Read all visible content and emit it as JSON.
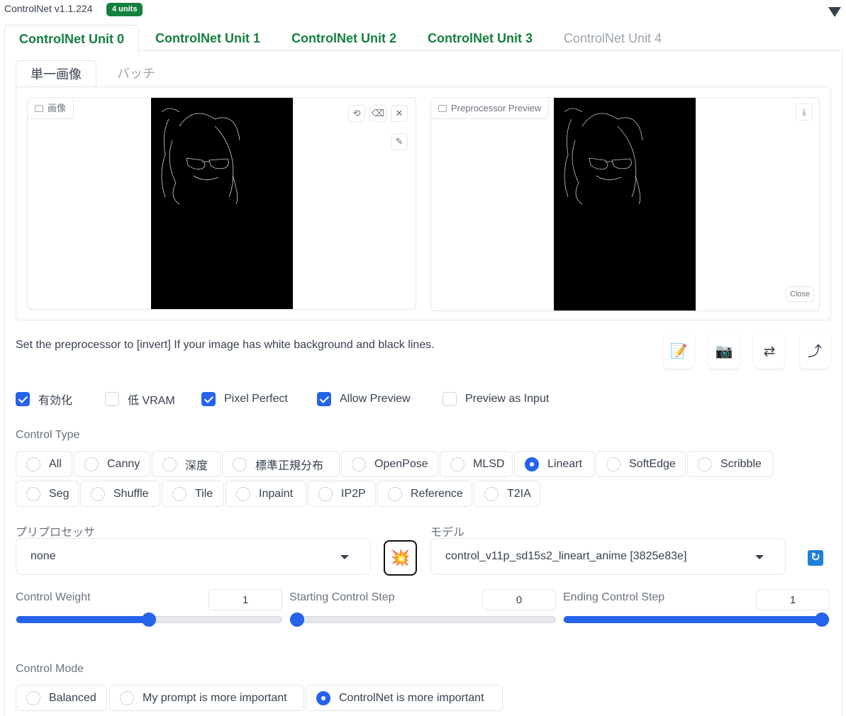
{
  "header": {
    "title": "ControlNet v1.1.224",
    "badge": "4 units"
  },
  "unit_tabs": [
    {
      "label": "ControlNet Unit 0",
      "active": true
    },
    {
      "label": "ControlNet Unit 1",
      "active": false
    },
    {
      "label": "ControlNet Unit 2",
      "active": false
    },
    {
      "label": "ControlNet Unit 3",
      "active": false
    },
    {
      "label": "ControlNet Unit 4",
      "active": false,
      "dimmed": true
    }
  ],
  "mode_tabs": [
    {
      "label": "単一画像",
      "active": true
    },
    {
      "label": "バッチ",
      "active": false
    }
  ],
  "image_panel": {
    "label": "画像",
    "icons": [
      "undo-icon",
      "eraser-icon",
      "close-icon",
      "brush-icon"
    ]
  },
  "preview_panel": {
    "label": "Preprocessor Preview",
    "download_icon": "download-icon",
    "close_label": "Close"
  },
  "hint": "Set the preprocessor to [invert] If your image has white background and black lines.",
  "tool_icons": [
    "notepad-icon",
    "camera-icon",
    "swap-icon",
    "arrow-up-right-icon"
  ],
  "checkboxes": [
    {
      "label": "有効化",
      "checked": true
    },
    {
      "label": "低 VRAM",
      "checked": false
    },
    {
      "label": "Pixel Perfect",
      "checked": true
    },
    {
      "label": "Allow Preview",
      "checked": true
    },
    {
      "label": "Preview as Input",
      "checked": false
    }
  ],
  "control_type": {
    "label": "Control Type",
    "row1": [
      "All",
      "Canny",
      "深度",
      "標準正規分布",
      "OpenPose",
      "MLSD",
      "Lineart",
      "SoftEdge",
      "Scribble"
    ],
    "row2": [
      "Seg",
      "Shuffle",
      "Tile",
      "Inpaint",
      "IP2P",
      "Reference",
      "T2IA"
    ],
    "selected": "Lineart"
  },
  "preprocessor": {
    "label": "プリプロセッサ",
    "value": "none"
  },
  "model": {
    "label": "モデル",
    "value": "control_v11p_sd15s2_lineart_anime [3825e83e]"
  },
  "sliders": [
    {
      "label": "Control Weight",
      "value": "1",
      "fraction": 0.5
    },
    {
      "label": "Starting Control Step",
      "value": "0",
      "fraction": 0.0
    },
    {
      "label": "Ending Control Step",
      "value": "1",
      "fraction": 1.0
    }
  ],
  "control_mode": {
    "label": "Control Mode",
    "options": [
      "Balanced",
      "My prompt is more important",
      "ControlNet is more important"
    ],
    "selected": "ControlNet is more important"
  },
  "colors": {
    "accent": "#2563eb",
    "tab_green": "#15803d"
  }
}
